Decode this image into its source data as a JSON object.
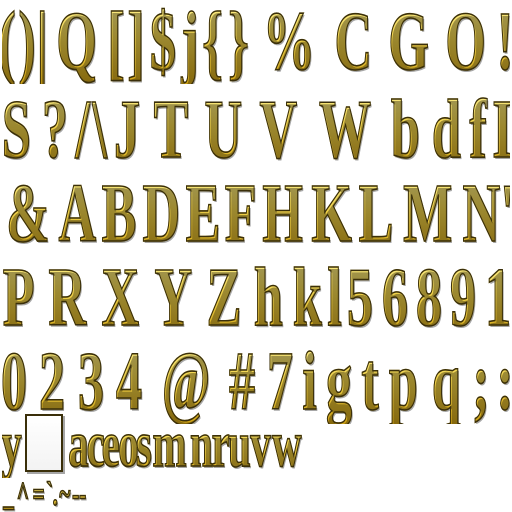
{
  "colors": {
    "glyph_fill_top": "#fbef8e",
    "glyph_fill_mid": "#f0d24a",
    "glyph_fill_bottom": "#cfa214",
    "glyph_outline": "#3a2f0a",
    "background": "#ffffff"
  },
  "rows": [
    {
      "glyphs": [
        "(",
        ")",
        "|",
        "Q",
        "[",
        "]",
        "$",
        "j",
        "{",
        "}",
        "%",
        "C",
        "G",
        "O",
        "!"
      ]
    },
    {
      "glyphs": [
        "S",
        "?",
        "/",
        "\\",
        "J",
        "T",
        "U",
        "V",
        "W",
        "b",
        "d",
        "f",
        "I"
      ]
    },
    {
      "glyphs": [
        "&",
        "A",
        "B",
        "D",
        "E",
        "F",
        "H",
        "K",
        "L",
        "M",
        "N",
        "'"
      ]
    },
    {
      "glyphs": [
        "P",
        "R",
        "X",
        "Y",
        "Z",
        "h",
        "k",
        "l",
        "5",
        "6",
        "8",
        "9",
        "1"
      ]
    },
    {
      "glyphs": [
        "0",
        "2",
        "3",
        "4",
        "@",
        "#",
        "7",
        "i",
        "g",
        "t",
        "p",
        "q",
        ";",
        ":"
      ]
    },
    {
      "glyphs": [
        "y",
        "",
        "a",
        "c",
        "e",
        "o",
        "s",
        "m",
        "n",
        "r",
        "u",
        "v",
        "w"
      ]
    },
    {
      "glyphs": [
        "_",
        "^",
        "=",
        "`",
        ".",
        "~",
        "-",
        "-"
      ]
    }
  ]
}
